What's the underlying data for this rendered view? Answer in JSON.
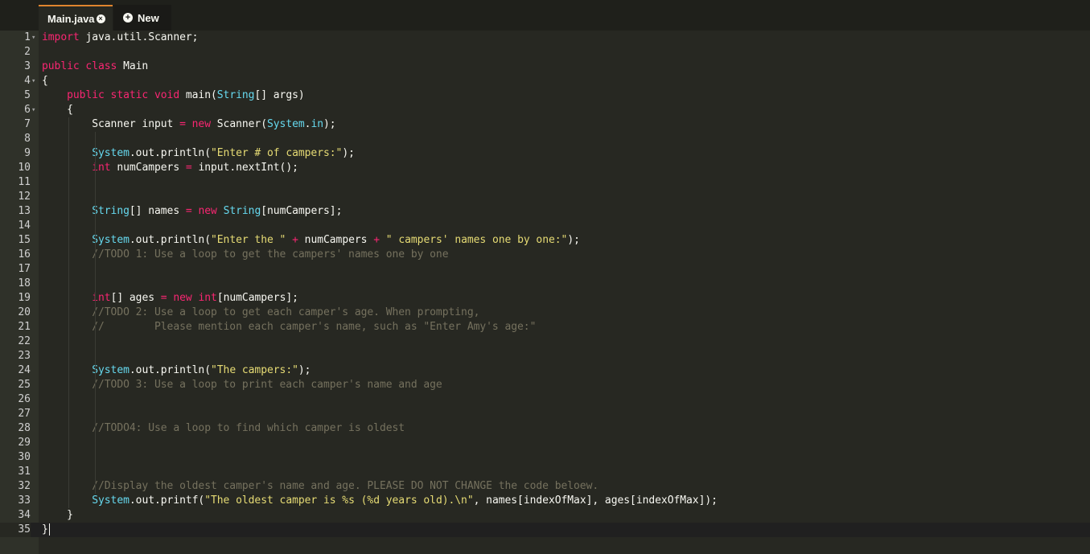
{
  "tabs": [
    {
      "label": "Main.java",
      "active": true
    },
    {
      "label": "New",
      "active": false
    }
  ],
  "colors": {
    "background": "#272822",
    "keyword": "#f92672",
    "type": "#66d9ef",
    "string": "#e6db74",
    "comment": "#75715e",
    "plain": "#f8f8f2",
    "tab_accent": "#e0842e"
  },
  "editor": {
    "active_line": 35,
    "fold_lines": [
      1,
      4,
      6
    ],
    "lines": [
      {
        "n": "1",
        "tokens": [
          [
            "k",
            "import"
          ],
          [
            "p",
            " java.util.Scanner;"
          ]
        ]
      },
      {
        "n": "2",
        "tokens": []
      },
      {
        "n": "3",
        "tokens": [
          [
            "k",
            "public class"
          ],
          [
            "p",
            " Main"
          ]
        ]
      },
      {
        "n": "4",
        "tokens": [
          [
            "p",
            "{"
          ]
        ]
      },
      {
        "n": "5",
        "tokens": [
          [
            "p",
            "    "
          ],
          [
            "k",
            "public static void"
          ],
          [
            "p",
            " main("
          ],
          [
            "t",
            "String"
          ],
          [
            "p",
            "[] args)"
          ]
        ]
      },
      {
        "n": "6",
        "tokens": [
          [
            "p",
            "    {"
          ]
        ]
      },
      {
        "n": "7",
        "tokens": [
          [
            "p",
            "        Scanner input "
          ],
          [
            "k",
            "="
          ],
          [
            "p",
            " "
          ],
          [
            "k",
            "new"
          ],
          [
            "p",
            " Scanner("
          ],
          [
            "t",
            "System"
          ],
          [
            "p",
            "."
          ],
          [
            "t",
            "in"
          ],
          [
            "p",
            ");"
          ]
        ]
      },
      {
        "n": "8",
        "tokens": []
      },
      {
        "n": "9",
        "tokens": [
          [
            "p",
            "        "
          ],
          [
            "t",
            "System"
          ],
          [
            "p",
            ".out.println("
          ],
          [
            "s",
            "\"Enter # of campers:\""
          ],
          [
            "p",
            ");"
          ]
        ]
      },
      {
        "n": "10",
        "tokens": [
          [
            "p",
            "        "
          ],
          [
            "k",
            "int"
          ],
          [
            "p",
            " numCampers "
          ],
          [
            "k",
            "="
          ],
          [
            "p",
            " input.nextInt();"
          ]
        ]
      },
      {
        "n": "11",
        "tokens": []
      },
      {
        "n": "12",
        "tokens": []
      },
      {
        "n": "13",
        "tokens": [
          [
            "p",
            "        "
          ],
          [
            "t",
            "String"
          ],
          [
            "p",
            "[] names "
          ],
          [
            "k",
            "="
          ],
          [
            "p",
            " "
          ],
          [
            "k",
            "new"
          ],
          [
            "p",
            " "
          ],
          [
            "t",
            "String"
          ],
          [
            "p",
            "[numCampers];"
          ]
        ]
      },
      {
        "n": "14",
        "tokens": []
      },
      {
        "n": "15",
        "tokens": [
          [
            "p",
            "        "
          ],
          [
            "t",
            "System"
          ],
          [
            "p",
            ".out.println("
          ],
          [
            "s",
            "\"Enter the \""
          ],
          [
            "p",
            " "
          ],
          [
            "k",
            "+"
          ],
          [
            "p",
            " numCampers "
          ],
          [
            "k",
            "+"
          ],
          [
            "p",
            " "
          ],
          [
            "s",
            "\" campers' names one by one:\""
          ],
          [
            "p",
            ");"
          ]
        ]
      },
      {
        "n": "16",
        "tokens": [
          [
            "p",
            "        "
          ],
          [
            "c",
            "//TODO 1: Use a loop to get the campers' names one by one"
          ]
        ]
      },
      {
        "n": "17",
        "tokens": []
      },
      {
        "n": "18",
        "tokens": []
      },
      {
        "n": "19",
        "tokens": [
          [
            "p",
            "        "
          ],
          [
            "k",
            "int"
          ],
          [
            "p",
            "[] ages "
          ],
          [
            "k",
            "="
          ],
          [
            "p",
            " "
          ],
          [
            "k",
            "new"
          ],
          [
            "p",
            " "
          ],
          [
            "k",
            "int"
          ],
          [
            "p",
            "[numCampers];"
          ]
        ]
      },
      {
        "n": "20",
        "tokens": [
          [
            "p",
            "        "
          ],
          [
            "c",
            "//TODO 2: Use a loop to get each camper's age. When prompting,"
          ]
        ]
      },
      {
        "n": "21",
        "tokens": [
          [
            "p",
            "        "
          ],
          [
            "c",
            "//        Please mention each camper's name, such as \"Enter Amy's age:\""
          ]
        ]
      },
      {
        "n": "22",
        "tokens": []
      },
      {
        "n": "23",
        "tokens": []
      },
      {
        "n": "24",
        "tokens": [
          [
            "p",
            "        "
          ],
          [
            "t",
            "System"
          ],
          [
            "p",
            ".out.println("
          ],
          [
            "s",
            "\"The campers:\""
          ],
          [
            "p",
            ");"
          ]
        ]
      },
      {
        "n": "25",
        "tokens": [
          [
            "p",
            "        "
          ],
          [
            "c",
            "//TODO 3: Use a loop to print each camper's name and age"
          ]
        ]
      },
      {
        "n": "26",
        "tokens": []
      },
      {
        "n": "27",
        "tokens": []
      },
      {
        "n": "28",
        "tokens": [
          [
            "p",
            "        "
          ],
          [
            "c",
            "//TODO4: Use a loop to find which camper is oldest"
          ]
        ]
      },
      {
        "n": "29",
        "tokens": []
      },
      {
        "n": "30",
        "tokens": []
      },
      {
        "n": "31",
        "tokens": []
      },
      {
        "n": "32",
        "tokens": [
          [
            "p",
            "        "
          ],
          [
            "c",
            "//Display the oldest camper's name and age. PLEASE DO NOT CHANGE the code beloew."
          ]
        ]
      },
      {
        "n": "33",
        "tokens": [
          [
            "p",
            "        "
          ],
          [
            "t",
            "System"
          ],
          [
            "p",
            ".out.printf("
          ],
          [
            "s",
            "\"The oldest camper is %s (%d years old).\\n\""
          ],
          [
            "p",
            ", names[indexOfMax], ages[indexOfMax]);"
          ]
        ]
      },
      {
        "n": "34",
        "tokens": [
          [
            "p",
            "    }"
          ]
        ]
      },
      {
        "n": "35",
        "tokens": [
          [
            "p",
            "}"
          ]
        ]
      }
    ]
  }
}
